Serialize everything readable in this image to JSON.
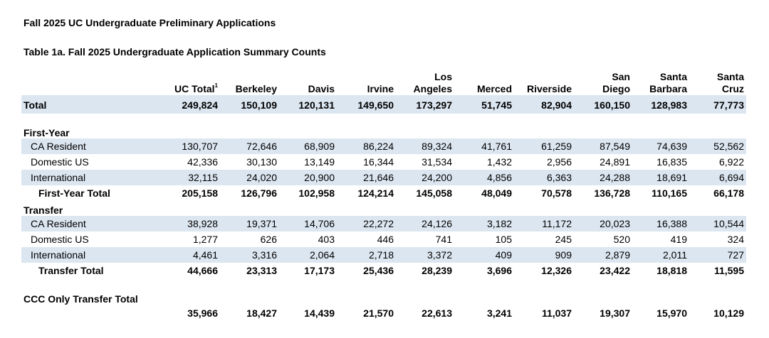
{
  "document": {
    "title": "Fall 2025 UC Undergraduate Preliminary Applications",
    "table_title": "Table 1a. Fall 2025 Undergraduate Application Summary Counts"
  },
  "table": {
    "columns": [
      {
        "line1": "",
        "line2": "UC Total",
        "sup": "1"
      },
      {
        "line1": "",
        "line2": "Berkeley",
        "sup": ""
      },
      {
        "line1": "",
        "line2": "Davis",
        "sup": ""
      },
      {
        "line1": "",
        "line2": "Irvine",
        "sup": ""
      },
      {
        "line1": "Los",
        "line2": "Angeles",
        "sup": ""
      },
      {
        "line1": "",
        "line2": "Merced",
        "sup": ""
      },
      {
        "line1": "",
        "line2": "Riverside",
        "sup": ""
      },
      {
        "line1": "San",
        "line2": "Diego",
        "sup": ""
      },
      {
        "line1": "Santa",
        "line2": "Barbara",
        "sup": ""
      },
      {
        "line1": "Santa",
        "line2": "Cruz",
        "sup": ""
      }
    ],
    "total": {
      "label": "Total",
      "values": [
        "249,824",
        "150,109",
        "120,131",
        "149,650",
        "173,297",
        "51,745",
        "82,904",
        "160,150",
        "128,983",
        "77,773"
      ]
    },
    "first_year": {
      "heading": "First-Year",
      "rows": [
        {
          "label": "CA Resident",
          "values": [
            "130,707",
            "72,646",
            "68,909",
            "86,224",
            "89,324",
            "41,761",
            "61,259",
            "87,549",
            "74,639",
            "52,562"
          ]
        },
        {
          "label": "Domestic US",
          "values": [
            "42,336",
            "30,130",
            "13,149",
            "16,344",
            "31,534",
            "1,432",
            "2,956",
            "24,891",
            "16,835",
            "6,922"
          ]
        },
        {
          "label": "International",
          "values": [
            "32,115",
            "24,020",
            "20,900",
            "21,646",
            "24,200",
            "4,856",
            "6,363",
            "24,288",
            "18,691",
            "6,694"
          ]
        }
      ],
      "subtotal": {
        "label": "First-Year Total",
        "values": [
          "205,158",
          "126,796",
          "102,958",
          "124,214",
          "145,058",
          "48,049",
          "70,578",
          "136,728",
          "110,165",
          "66,178"
        ]
      }
    },
    "transfer": {
      "heading": "Transfer",
      "rows": [
        {
          "label": "CA Resident",
          "values": [
            "38,928",
            "19,371",
            "14,706",
            "22,272",
            "24,126",
            "3,182",
            "11,172",
            "20,023",
            "16,388",
            "10,544"
          ]
        },
        {
          "label": "Domestic US",
          "values": [
            "1,277",
            "626",
            "403",
            "446",
            "741",
            "105",
            "245",
            "520",
            "419",
            "324"
          ]
        },
        {
          "label": "International",
          "values": [
            "4,461",
            "3,316",
            "2,064",
            "2,718",
            "3,372",
            "409",
            "909",
            "2,879",
            "2,011",
            "727"
          ]
        }
      ],
      "subtotal": {
        "label": "Transfer Total",
        "values": [
          "44,666",
          "23,313",
          "17,173",
          "25,436",
          "28,239",
          "3,696",
          "12,326",
          "23,422",
          "18,818",
          "11,595"
        ]
      }
    },
    "ccc": {
      "label": "CCC Only Transfer Total",
      "values": [
        "35,966",
        "18,427",
        "14,439",
        "21,570",
        "22,613",
        "3,241",
        "11,037",
        "19,307",
        "15,970",
        "10,129"
      ]
    }
  },
  "colors": {
    "row_shade": "#dce6f1"
  }
}
